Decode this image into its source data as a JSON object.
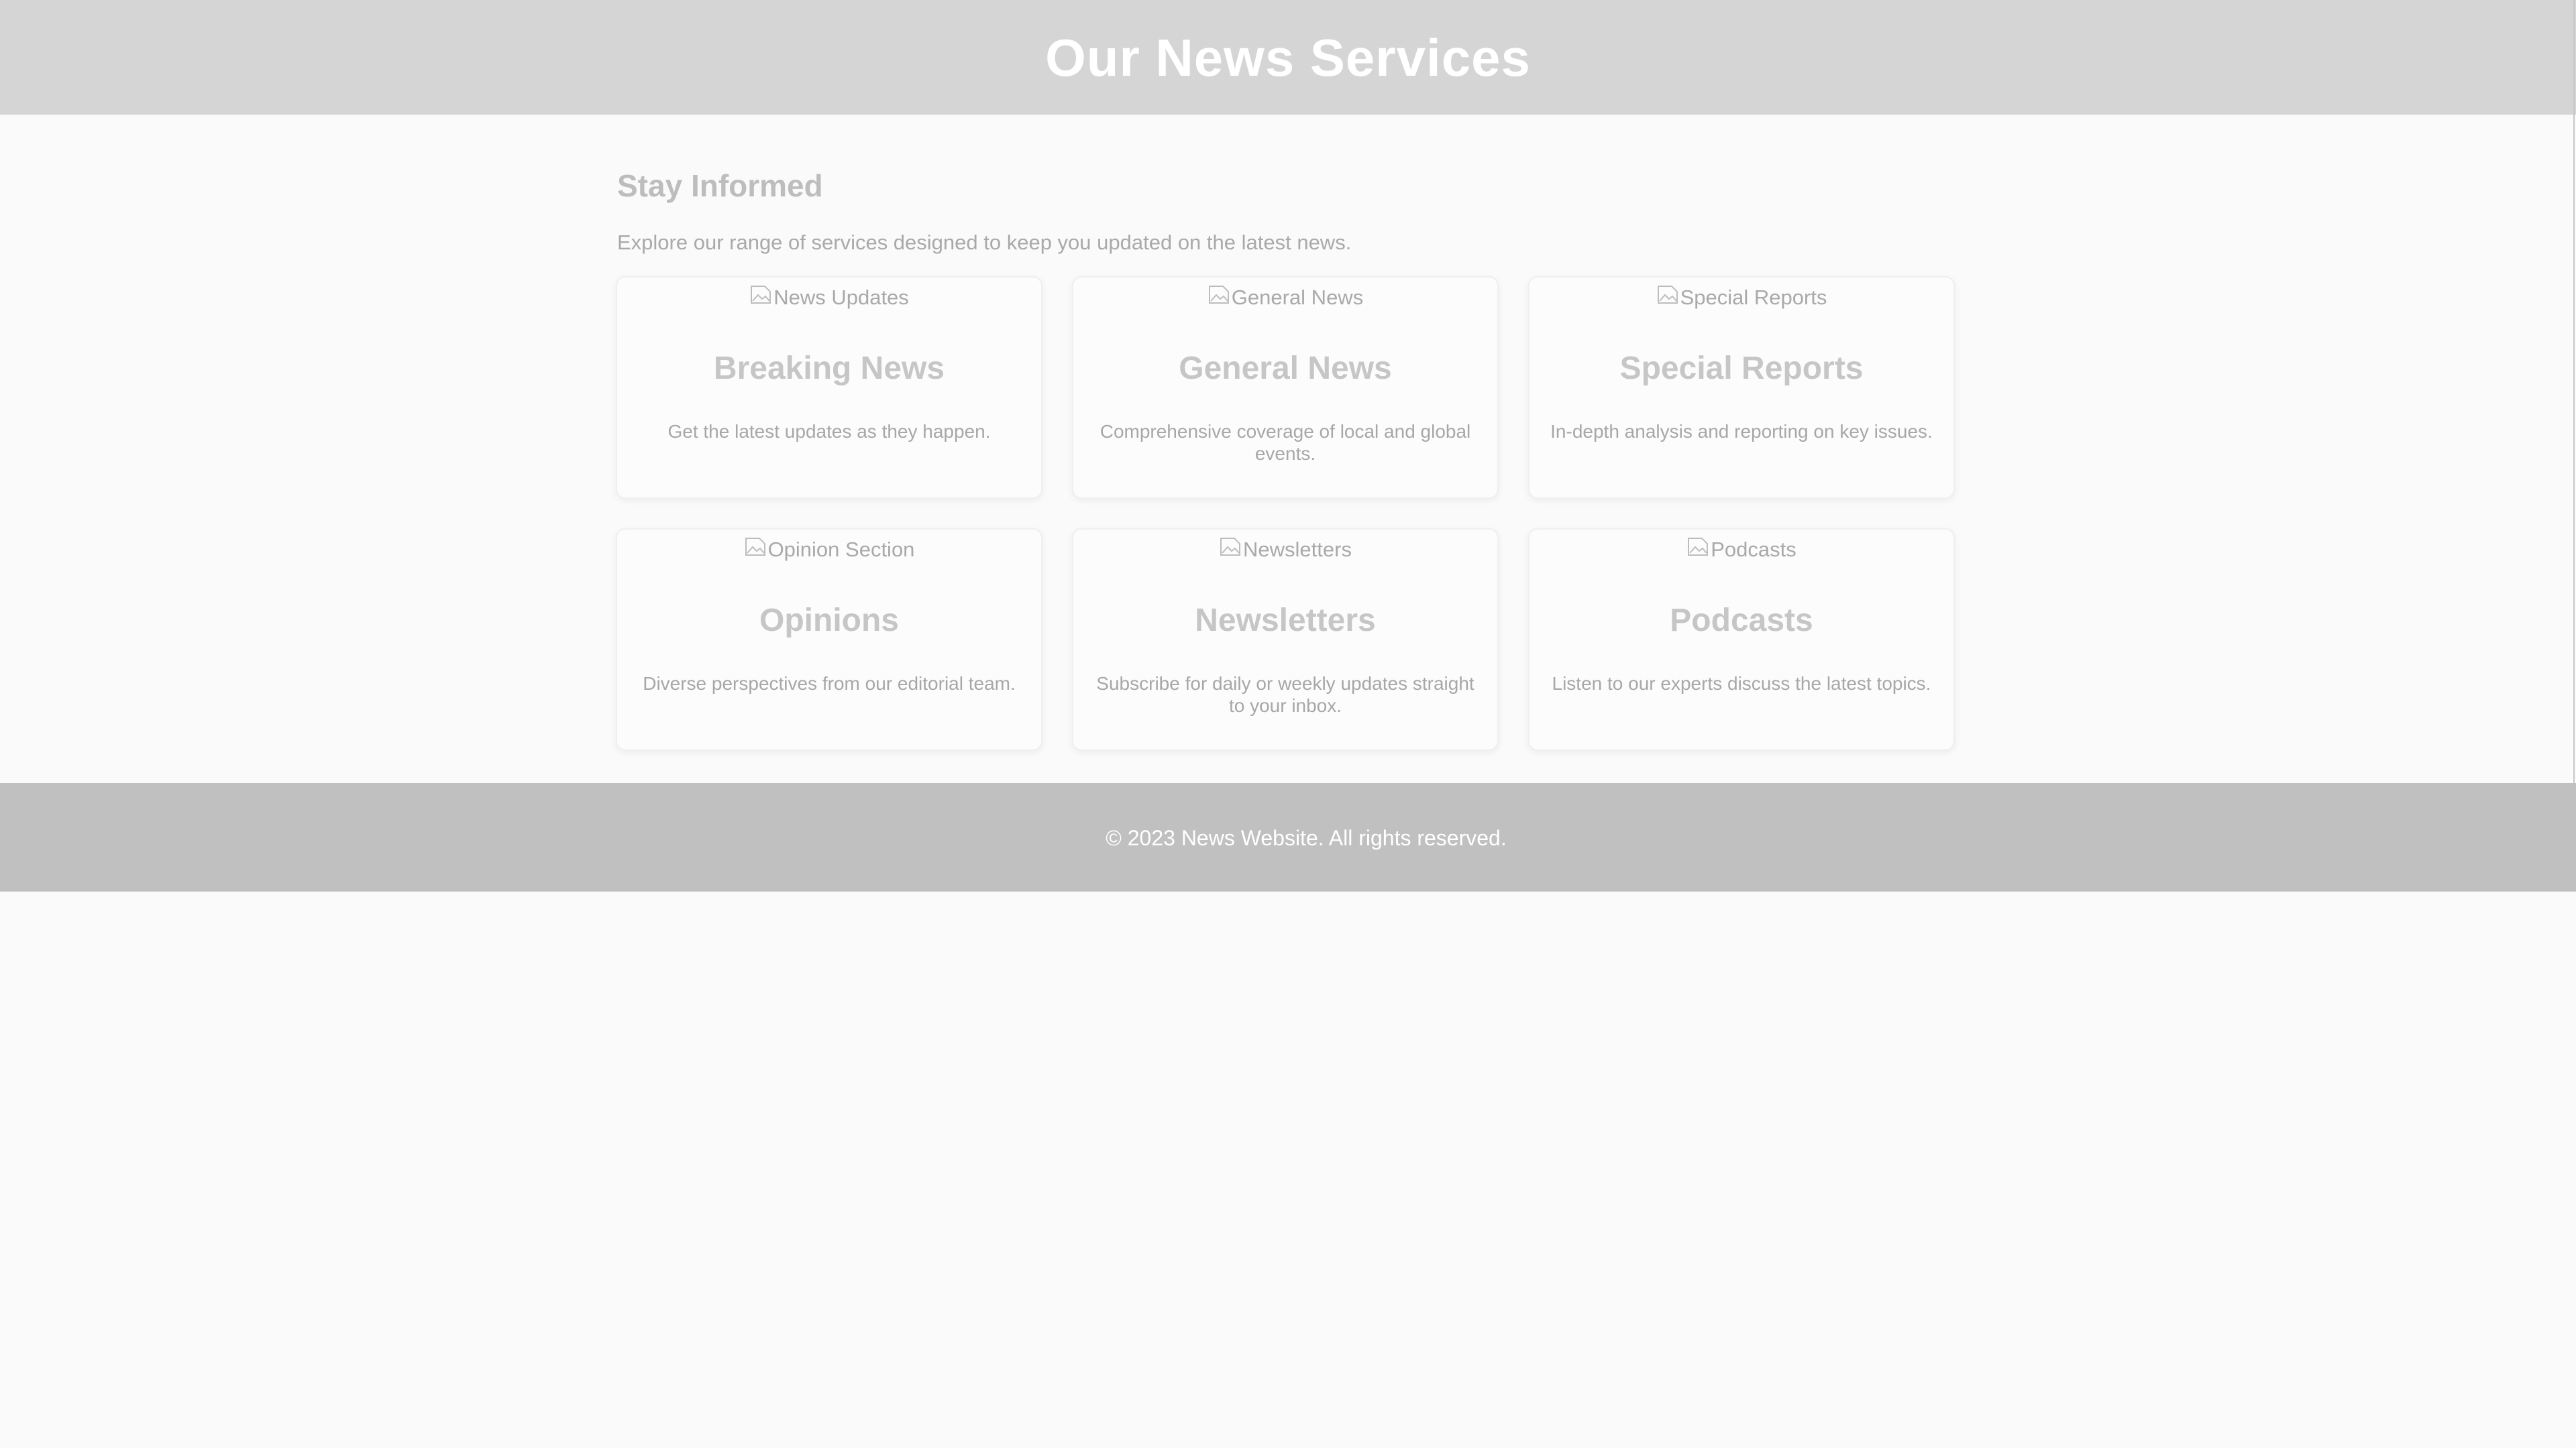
{
  "header": {
    "title": "Our News Services"
  },
  "intro": {
    "heading": "Stay Informed",
    "description": "Explore our range of services designed to keep you updated on the latest news."
  },
  "services": [
    {
      "image_alt": "News Updates",
      "title": "Breaking News",
      "description": "Get the latest updates as they happen."
    },
    {
      "image_alt": "General News",
      "title": "General News",
      "description": "Comprehensive coverage of local and global events."
    },
    {
      "image_alt": "Special Reports",
      "title": "Special Reports",
      "description": "In-depth analysis and reporting on key issues."
    },
    {
      "image_alt": "Opinion Section",
      "title": "Opinions",
      "description": "Diverse perspectives from our editorial team."
    },
    {
      "image_alt": "Newsletters",
      "title": "Newsletters",
      "description": "Subscribe for daily or weekly updates straight to your inbox."
    },
    {
      "image_alt": "Podcasts",
      "title": "Podcasts",
      "description": "Listen to our experts discuss the latest topics."
    }
  ],
  "footer": {
    "text": "© 2023 News Website. All rights reserved."
  },
  "colors": {
    "header_bg": "#d5d5d5",
    "footer_bg": "#c0c0c0",
    "page_bg": "#fafafa"
  }
}
